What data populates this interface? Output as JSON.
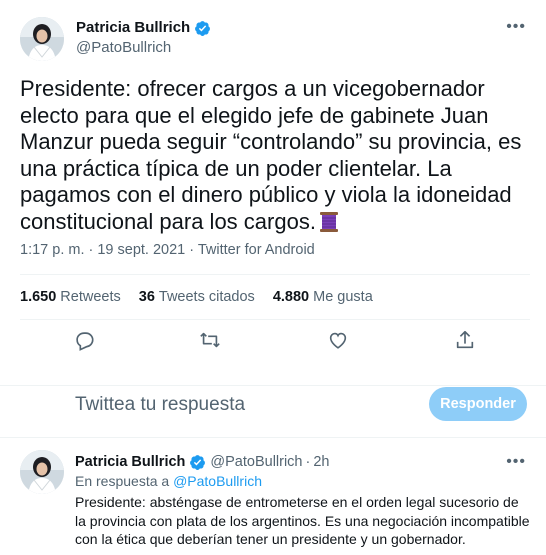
{
  "main_tweet": {
    "author_name": "Patricia Bullrich",
    "author_handle": "@PatoBullrich",
    "text": "Presidente: ofrecer cargos a un vicegobernador electo para que el elegido jefe de gabinete Juan Manzur pueda seguir “controlando”  su provincia, es una práctica típica de un poder clientelar. La pagamos con el dinero público y viola la idoneidad constitucional para los cargos.",
    "emoji_icon": "spool-of-thread-icon",
    "timestamp": "1:17 p. m. · 19 sept. 2021 · ",
    "source": "Twitter for Android",
    "stats": [
      {
        "number": "1.650",
        "label": "Retweets"
      },
      {
        "number": "36",
        "label": "Tweets citados"
      },
      {
        "number": "4.880",
        "label": "Me gusta"
      }
    ],
    "actions": [
      "reply-icon",
      "retweet-icon",
      "like-icon",
      "share-icon"
    ]
  },
  "reply_composer": {
    "placeholder": "Twittea tu respuesta",
    "button_label": "Responder"
  },
  "reply_tweet": {
    "author_name": "Patricia Bullrich",
    "author_handle": "@PatoBullrich",
    "separator": "·",
    "time": "2h",
    "in_reply_prefix": "En respuesta a ",
    "in_reply_mention": "@PatoBullrich",
    "text": "Presidente: absténgase de entrometerse en el orden legal sucesorio de la provincia con plata de los argentinos. Es una negociación incompatible con la ética que deberían tener un presidente y un gobernador."
  },
  "colors": {
    "accent": "#1d9bf0",
    "button_disabled": "#8ecdf8",
    "muted_text": "#536471",
    "border": "#eff3f4"
  }
}
